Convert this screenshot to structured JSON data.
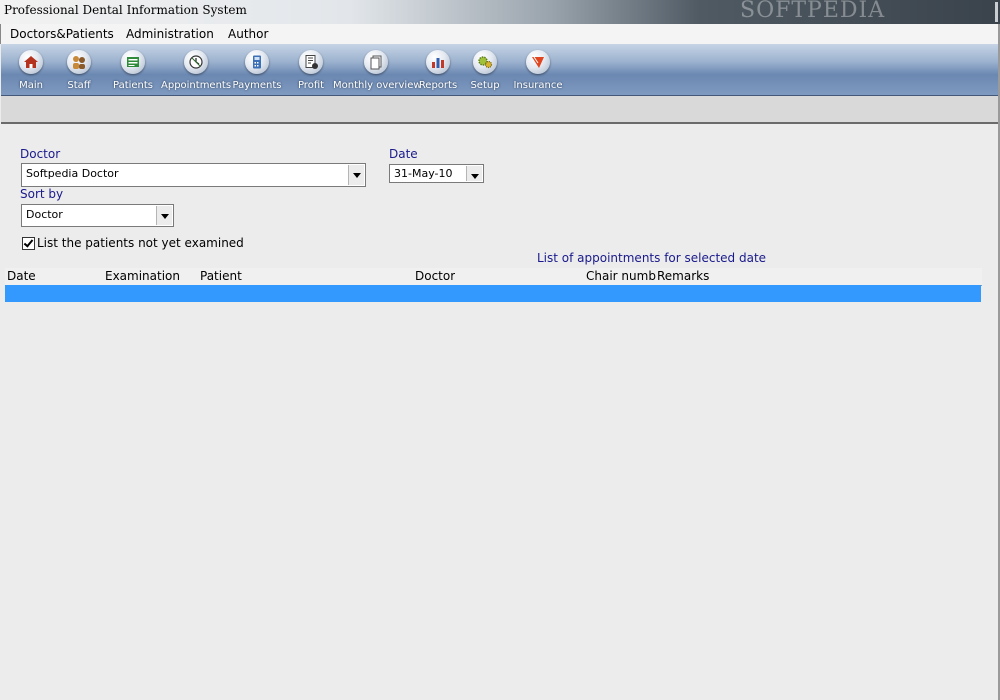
{
  "window": {
    "title": "Professional Dental Information System",
    "watermark": "SOFTPEDIA"
  },
  "menu": [
    {
      "label": "Doctors&Patients"
    },
    {
      "label": "Administration"
    },
    {
      "label": "Author"
    }
  ],
  "toolbar": [
    {
      "label": "Main",
      "icon": "house-icon"
    },
    {
      "label": "Staff",
      "icon": "staff-icon"
    },
    {
      "label": "Patients",
      "icon": "patients-icon"
    },
    {
      "label": "Appointments",
      "icon": "appointments-icon"
    },
    {
      "label": "Payments",
      "icon": "payments-icon"
    },
    {
      "label": "Profit",
      "icon": "profit-icon"
    },
    {
      "label": "Monthly overview",
      "icon": "monthly-overview-icon"
    },
    {
      "label": "Reports",
      "icon": "reports-icon"
    },
    {
      "label": "Setup",
      "icon": "setup-icon"
    },
    {
      "label": "Insurance",
      "icon": "insurance-icon"
    }
  ],
  "form": {
    "doctor_label": "Doctor",
    "doctor_value": "Softpedia Doctor",
    "date_label": "Date",
    "date_value": "31-May-10",
    "sort_label": "Sort by",
    "sort_value": "Doctor",
    "checkbox_label": "List the patients not yet examined",
    "checkbox_checked": true
  },
  "appointments": {
    "caption": "List of appointments for selected date",
    "columns": [
      "Date",
      "Examination",
      "Patient",
      "Doctor",
      "Chair numb",
      "Remarks"
    ],
    "selection_color": "#3399ff"
  },
  "colors": {
    "label": "#1a1a8c",
    "toolbar": "#7f9ac0"
  }
}
